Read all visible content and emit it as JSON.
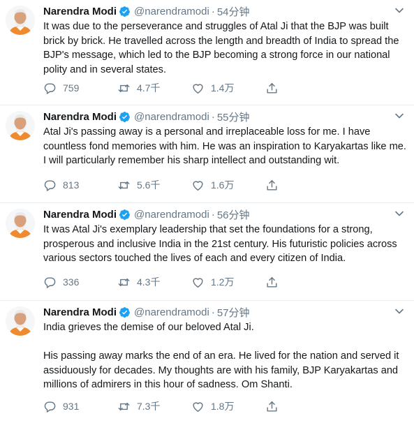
{
  "tweets": [
    {
      "name": "Narendra Modi",
      "handle": "@narendramodi",
      "separator": "·",
      "time": "54分钟",
      "paragraphs": [
        "It was due to the perseverance and struggles of Atal Ji that the BJP was built brick by brick. He travelled across the length and breadth of India to spread the BJP's message, which led to the BJP becoming a strong force in our national polity and in several states."
      ],
      "replies": "759",
      "retweets": "4.7千",
      "likes": "1.4万"
    },
    {
      "name": "Narendra Modi",
      "handle": "@narendramodi",
      "separator": "·",
      "time": "55分钟",
      "paragraphs": [
        "Atal Ji's passing away is a personal and irreplaceable loss for me. I have countless fond memories with him. He was an inspiration to Karyakartas like me. I will particularly remember his sharp intellect and outstanding wit."
      ],
      "replies": "813",
      "retweets": "5.6千",
      "likes": "1.6万"
    },
    {
      "name": "Narendra Modi",
      "handle": "@narendramodi",
      "separator": "·",
      "time": "56分钟",
      "paragraphs": [
        "It was Atal Ji's exemplary leadership that set the foundations for a strong, prosperous and inclusive India in the 21st century. His futuristic policies across various sectors touched the lives of each and every citizen of India."
      ],
      "replies": "336",
      "retweets": "4.3千",
      "likes": "1.2万"
    },
    {
      "name": "Narendra Modi",
      "handle": "@narendramodi",
      "separator": "·",
      "time": "57分钟",
      "paragraphs": [
        "India grieves the demise of our beloved Atal Ji.",
        "His passing away marks the end of an era. He lived for the nation and served it assiduously for decades. My thoughts are with his family, BJP Karyakartas and millions of admirers in this hour of sadness. Om Shanti."
      ],
      "replies": "931",
      "retweets": "7.3千",
      "likes": "1.8万"
    }
  ],
  "colors": {
    "verified": "#1da1f2",
    "secondary_text": "#657786",
    "primary_text": "#14171a",
    "divider": "#e6ecf0"
  },
  "icons": {
    "reply": "reply-icon",
    "retweet": "retweet-icon",
    "like": "like-icon",
    "share": "share-icon",
    "verified": "verified-badge-icon",
    "caret": "chevron-down-icon"
  }
}
